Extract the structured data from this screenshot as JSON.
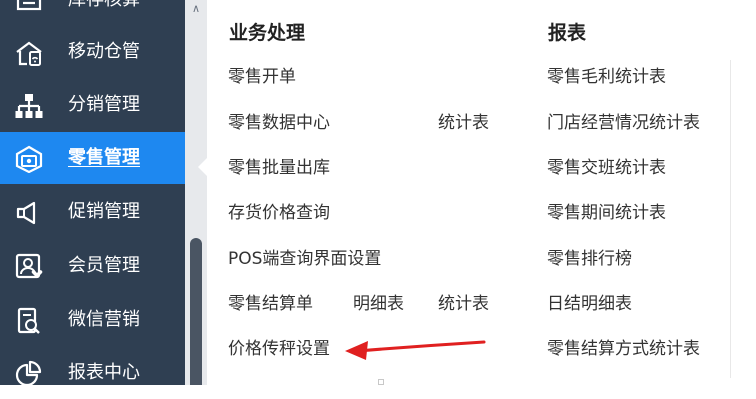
{
  "sidebar": {
    "items": [
      {
        "label": "库存核算",
        "icon": "inventory-icon"
      },
      {
        "label": "移动仓管",
        "icon": "mobile-warehouse-icon"
      },
      {
        "label": "分销管理",
        "icon": "hierarchy-icon"
      },
      {
        "label": "零售管理",
        "icon": "retail-icon"
      },
      {
        "label": "促销管理",
        "icon": "megaphone-icon"
      },
      {
        "label": "会员管理",
        "icon": "member-icon"
      },
      {
        "label": "微信营销",
        "icon": "wechat-icon"
      },
      {
        "label": "报表中心",
        "icon": "pie-chart-icon"
      }
    ],
    "active_index": 3,
    "colors": {
      "background": "#2f3f52",
      "active": "#1e88f0",
      "text": "#ffffff"
    }
  },
  "submenu": {
    "business": {
      "header": "业务处理",
      "items": {
        "retail_order": "零售开单",
        "retail_data_center": "零售数据中心",
        "statistics_table_1": "统计表",
        "retail_bulk_outbound": "零售批量出库",
        "inventory_price_query": "存货价格查询",
        "pos_query_settings": "POS端查询界面设置",
        "retail_settlement": "零售结算单",
        "detail_table": "明细表",
        "statistics_table_2": "统计表",
        "price_scale_settings": "价格传秤设置"
      }
    },
    "reports": {
      "header": "报表",
      "items": [
        "零售毛利统计表",
        "门店经营情况统计表",
        "零售交班统计表",
        "零售期间统计表",
        "零售排行榜",
        "日结明细表",
        "零售结算方式统计表"
      ]
    }
  },
  "annotation": {
    "color": "#e02020",
    "target": "价格传秤设置"
  }
}
